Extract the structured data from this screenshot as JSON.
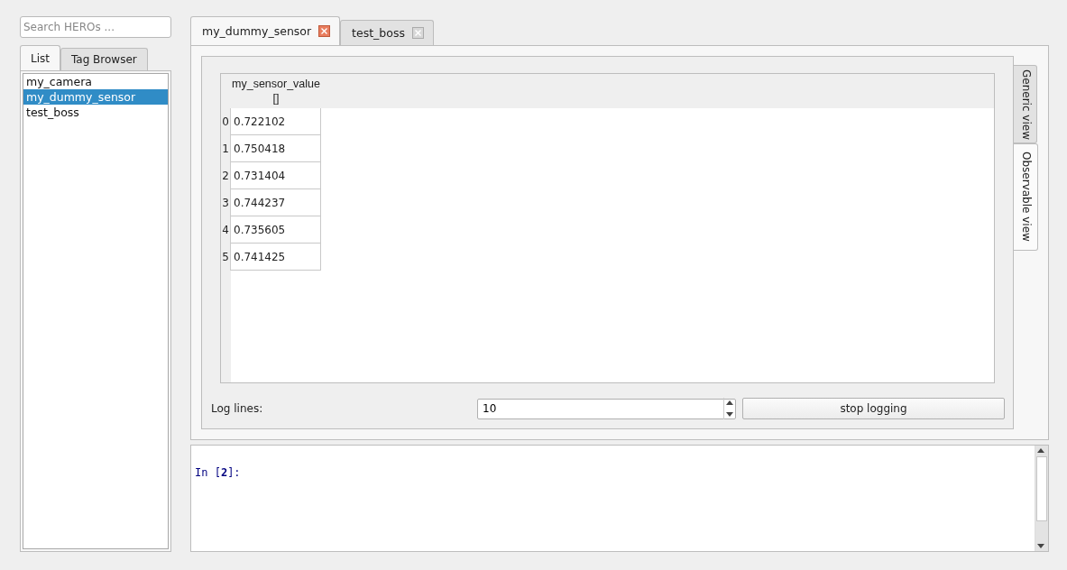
{
  "search": {
    "placeholder": "Search HEROs ..."
  },
  "side_tabs": [
    {
      "label": "List",
      "selected": true
    },
    {
      "label": "Tag Browser",
      "selected": false
    }
  ],
  "hero_list": [
    {
      "label": "my_camera",
      "selected": false
    },
    {
      "label": "my_dummy_sensor",
      "selected": true
    },
    {
      "label": "test_boss",
      "selected": false
    }
  ],
  "doc_tabs": [
    {
      "label": "my_dummy_sensor",
      "selected": true
    },
    {
      "label": "test_boss",
      "selected": false
    }
  ],
  "view_tabs": [
    {
      "label": "Generic view",
      "selected": false
    },
    {
      "label": "Observable view",
      "selected": true
    }
  ],
  "table": {
    "columns": [
      "my_sensor_value\n[]"
    ],
    "rows": [
      {
        "index": "0",
        "cells": [
          "0.722102"
        ]
      },
      {
        "index": "1",
        "cells": [
          "0.750418"
        ]
      },
      {
        "index": "2",
        "cells": [
          "0.731404"
        ]
      },
      {
        "index": "3",
        "cells": [
          "0.744237"
        ]
      },
      {
        "index": "4",
        "cells": [
          "0.735605"
        ]
      },
      {
        "index": "5",
        "cells": [
          "0.741425"
        ]
      }
    ]
  },
  "log_lines": {
    "label": "Log lines:",
    "value": "10"
  },
  "stop_button": "stop logging",
  "console": {
    "prompt": "In [**2**]:"
  }
}
